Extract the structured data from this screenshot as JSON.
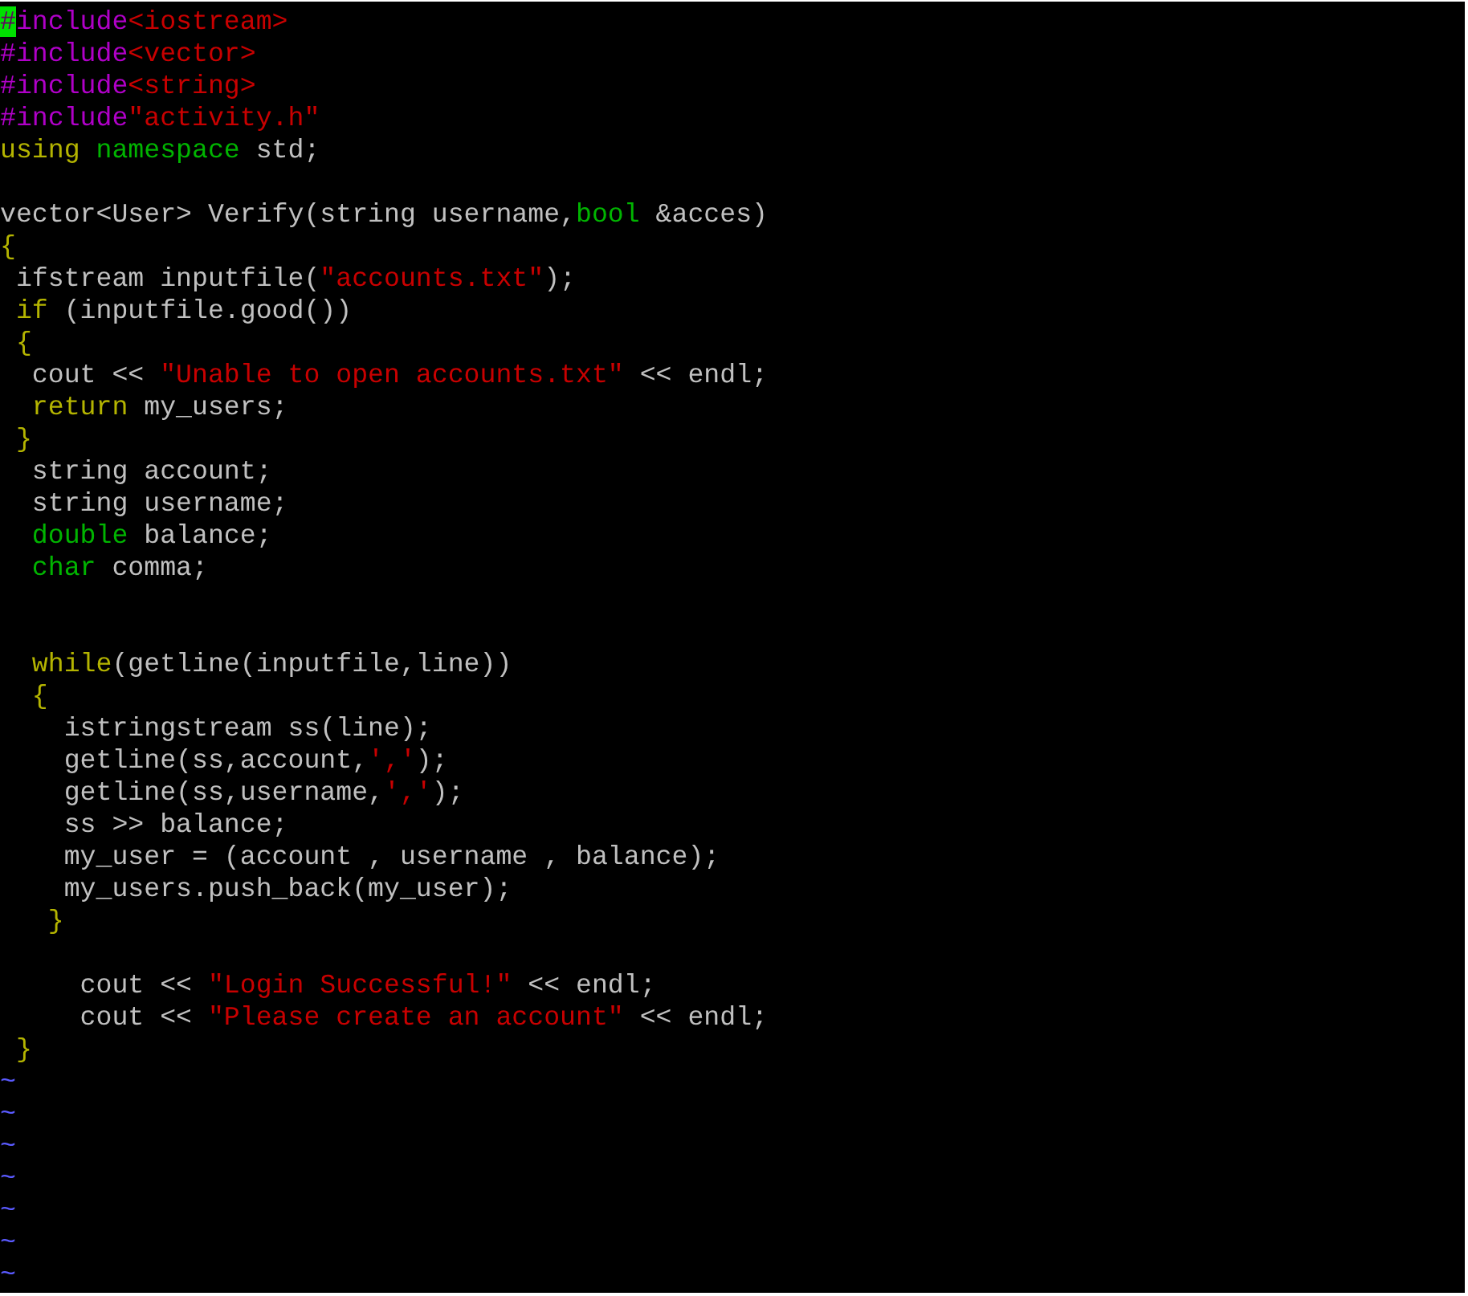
{
  "editor": {
    "lines": [
      {
        "segments": [
          {
            "kind": "preproc",
            "text": "#",
            "cursor": true
          },
          {
            "kind": "preproc",
            "text": "include"
          },
          {
            "kind": "string",
            "text": "<iostream>"
          }
        ]
      },
      {
        "segments": [
          {
            "kind": "preproc",
            "text": "#include"
          },
          {
            "kind": "string",
            "text": "<vector>"
          }
        ]
      },
      {
        "segments": [
          {
            "kind": "preproc",
            "text": "#include"
          },
          {
            "kind": "string",
            "text": "<string>"
          }
        ]
      },
      {
        "segments": [
          {
            "kind": "preproc",
            "text": "#include"
          },
          {
            "kind": "string",
            "text": "\"activity.h\""
          }
        ]
      },
      {
        "segments": [
          {
            "kind": "keyword",
            "text": "using"
          },
          {
            "kind": "type",
            "text": " namespace"
          },
          {
            "kind": "plain",
            "text": " std;"
          }
        ]
      },
      {
        "kind": "blank"
      },
      {
        "segments": [
          {
            "kind": "plain",
            "text": "vector<User> Verify(string username,"
          },
          {
            "kind": "type",
            "text": "bool"
          },
          {
            "kind": "plain",
            "text": " &acces)"
          }
        ]
      },
      {
        "segments": [
          {
            "kind": "keyword",
            "text": "{"
          }
        ]
      },
      {
        "segments": [
          {
            "kind": "plain",
            "text": " ifstream inputfile("
          },
          {
            "kind": "string",
            "text": "\"accounts.txt\""
          },
          {
            "kind": "plain",
            "text": ");"
          }
        ]
      },
      {
        "segments": [
          {
            "kind": "keyword",
            "text": " if"
          },
          {
            "kind": "plain",
            "text": " (inputfile.good())"
          }
        ]
      },
      {
        "segments": [
          {
            "kind": "keyword",
            "text": " {"
          }
        ]
      },
      {
        "segments": [
          {
            "kind": "plain",
            "text": "  cout << "
          },
          {
            "kind": "string",
            "text": "\"Unable to open accounts.txt\""
          },
          {
            "kind": "plain",
            "text": " << endl;"
          }
        ]
      },
      {
        "segments": [
          {
            "kind": "keyword",
            "text": "  return"
          },
          {
            "kind": "plain",
            "text": " my_users;"
          }
        ]
      },
      {
        "segments": [
          {
            "kind": "keyword",
            "text": " }"
          }
        ]
      },
      {
        "segments": [
          {
            "kind": "plain",
            "text": "  string account;"
          }
        ]
      },
      {
        "segments": [
          {
            "kind": "plain",
            "text": "  string username;"
          }
        ]
      },
      {
        "segments": [
          {
            "kind": "type",
            "text": "  double"
          },
          {
            "kind": "plain",
            "text": " balance;"
          }
        ]
      },
      {
        "segments": [
          {
            "kind": "type",
            "text": "  char"
          },
          {
            "kind": "plain",
            "text": " comma;"
          }
        ]
      },
      {
        "kind": "blank"
      },
      {
        "kind": "blank"
      },
      {
        "segments": [
          {
            "kind": "keyword",
            "text": "  while"
          },
          {
            "kind": "plain",
            "text": "(getline(inputfile,line))"
          }
        ]
      },
      {
        "segments": [
          {
            "kind": "keyword",
            "text": "  {"
          }
        ]
      },
      {
        "segments": [
          {
            "kind": "plain",
            "text": "    istringstream ss(line);"
          }
        ]
      },
      {
        "segments": [
          {
            "kind": "plain",
            "text": "    getline(ss,account,"
          },
          {
            "kind": "string",
            "text": "','"
          },
          {
            "kind": "plain",
            "text": ");"
          }
        ]
      },
      {
        "segments": [
          {
            "kind": "plain",
            "text": "    getline(ss,username,"
          },
          {
            "kind": "string",
            "text": "','"
          },
          {
            "kind": "plain",
            "text": ");"
          }
        ]
      },
      {
        "segments": [
          {
            "kind": "plain",
            "text": "    ss >> balance;"
          }
        ]
      },
      {
        "segments": [
          {
            "kind": "plain",
            "text": "    my_user = (account , username , balance);"
          }
        ]
      },
      {
        "segments": [
          {
            "kind": "plain",
            "text": "    my_users.push_back(my_user);"
          }
        ]
      },
      {
        "segments": [
          {
            "kind": "keyword",
            "text": "   }"
          }
        ]
      },
      {
        "kind": "blank"
      },
      {
        "segments": [
          {
            "kind": "plain",
            "text": "     cout << "
          },
          {
            "kind": "string",
            "text": "\"Login Successful!\""
          },
          {
            "kind": "plain",
            "text": " << endl;"
          }
        ]
      },
      {
        "segments": [
          {
            "kind": "plain",
            "text": "     cout << "
          },
          {
            "kind": "string",
            "text": "\"Please create an account\""
          },
          {
            "kind": "plain",
            "text": " << endl;"
          }
        ]
      },
      {
        "segments": [
          {
            "kind": "keyword",
            "text": " }"
          }
        ]
      }
    ],
    "empty_line_markers": [
      "~",
      "~",
      "~",
      "~",
      "~",
      "~",
      "~"
    ]
  }
}
